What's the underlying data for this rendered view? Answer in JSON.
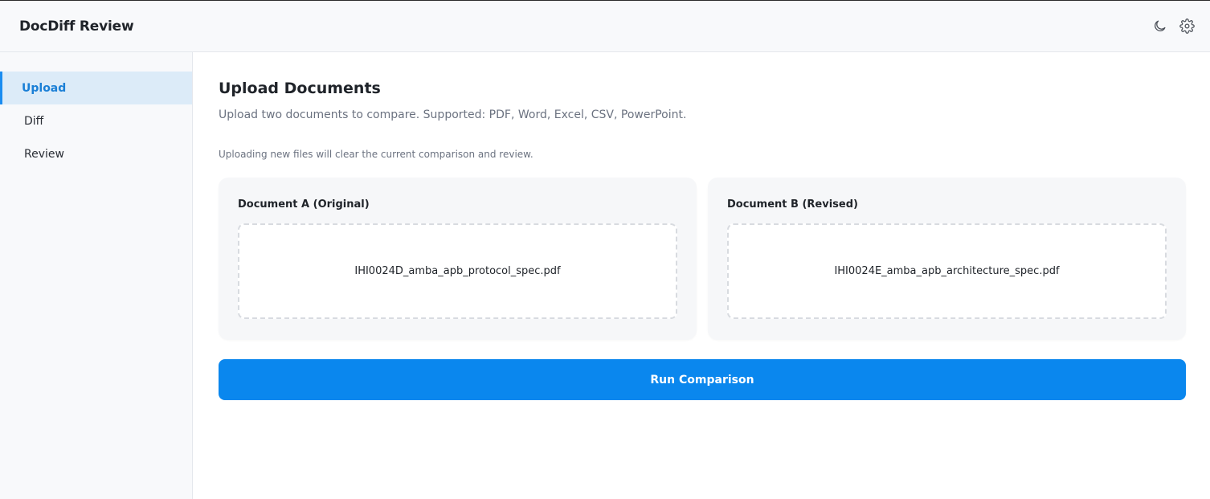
{
  "header": {
    "title": "DocDiff Review",
    "icons": [
      "moon-icon",
      "gear-icon"
    ]
  },
  "sidebar": {
    "items": [
      {
        "label": "Upload",
        "active": true
      },
      {
        "label": "Diff",
        "active": false
      },
      {
        "label": "Review",
        "active": false
      }
    ]
  },
  "main": {
    "title": "Upload Documents",
    "subtitle": "Upload two documents to compare. Supported: PDF, Word, Excel, CSV, PowerPoint.",
    "note": "Uploading new files will clear the current comparison and review.",
    "documents": [
      {
        "label": "Document A (Original)",
        "filename": "IHI0024D_amba_apb_protocol_spec.pdf"
      },
      {
        "label": "Document B (Revised)",
        "filename": "IHI0024E_amba_apb_architecture_spec.pdf"
      }
    ],
    "run_label": "Run Comparison"
  },
  "colors": {
    "accent": "#0a87ee",
    "active_nav_bg": "#dcebf8",
    "active_nav_text": "#1a7fd6"
  }
}
